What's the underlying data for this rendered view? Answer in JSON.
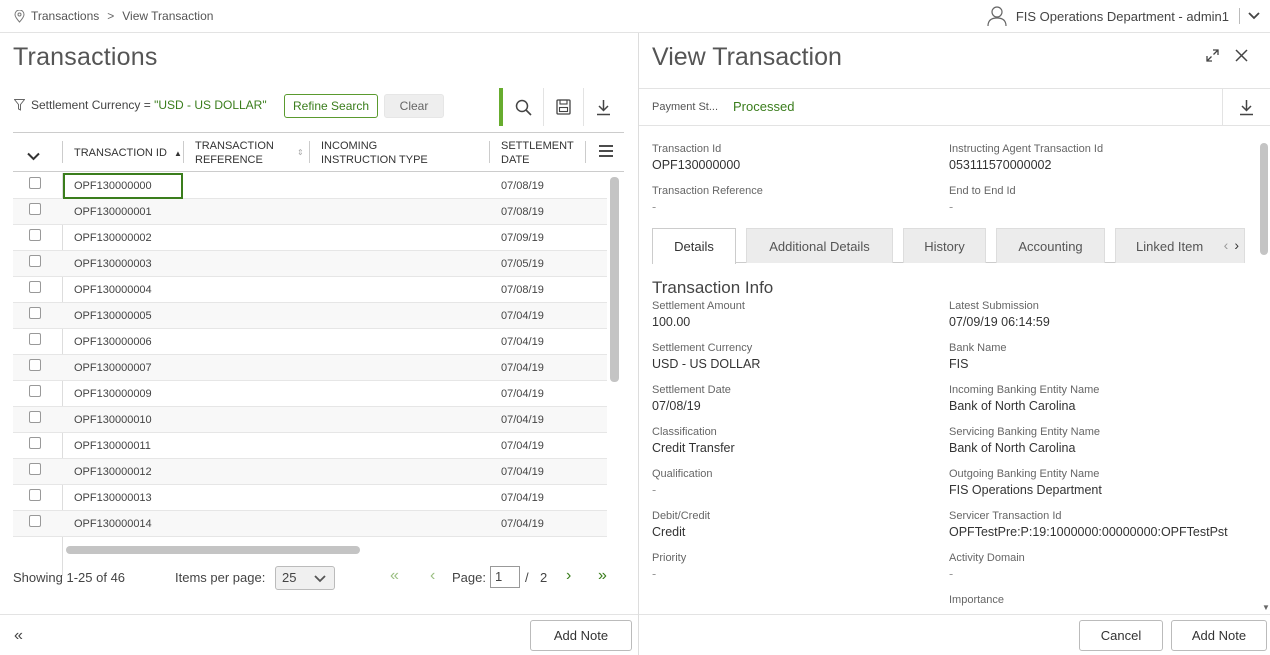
{
  "breadcrumb": {
    "root": "Transactions",
    "separator": ">",
    "current": "View Transaction"
  },
  "user": {
    "label": "FIS Operations Department - admin1"
  },
  "left": {
    "title": "Transactions",
    "filter": {
      "prefix": "Settlement Currency = ",
      "value": "\"USD - US DOLLAR\""
    },
    "refine_label": "Refine Search",
    "clear_label": "Clear",
    "columns": [
      "TRANSACTION ID",
      "TRANSACTION REFERENCE",
      "INCOMING INSTRUCTION TYPE",
      "SETTLEMENT DATE"
    ],
    "rows": [
      {
        "id": "OPF130000000",
        "date": "07/08/19"
      },
      {
        "id": "OPF130000001",
        "date": "07/08/19"
      },
      {
        "id": "OPF130000002",
        "date": "07/09/19"
      },
      {
        "id": "OPF130000003",
        "date": "07/05/19"
      },
      {
        "id": "OPF130000004",
        "date": "07/08/19"
      },
      {
        "id": "OPF130000005",
        "date": "07/04/19"
      },
      {
        "id": "OPF130000006",
        "date": "07/04/19"
      },
      {
        "id": "OPF130000007",
        "date": "07/04/19"
      },
      {
        "id": "OPF130000009",
        "date": "07/04/19"
      },
      {
        "id": "OPF130000010",
        "date": "07/04/19"
      },
      {
        "id": "OPF130000011",
        "date": "07/04/19"
      },
      {
        "id": "OPF130000012",
        "date": "07/04/19"
      },
      {
        "id": "OPF130000013",
        "date": "07/04/19"
      },
      {
        "id": "OPF130000014",
        "date": "07/04/19"
      }
    ],
    "pager": {
      "showing": "Showing 1-25 of 46",
      "items_per_page_label": "Items per page:",
      "items_per_page": "25",
      "page_label": "Page:",
      "page": "1",
      "slash": "/",
      "total_pages": "2"
    },
    "add_note_label": "Add Note"
  },
  "right": {
    "title": "View Transaction",
    "status_label": "Payment St...",
    "status_value": "Processed",
    "top_fields": [
      {
        "label": "Transaction Id",
        "value": "OPF130000000"
      },
      {
        "label": "Instructing Agent Transaction Id",
        "value": "053111570000002"
      },
      {
        "label": "Transaction Reference",
        "value": "-"
      },
      {
        "label": "End to End Id",
        "value": "-"
      }
    ],
    "tabs": [
      "Details",
      "Additional Details",
      "History",
      "Accounting",
      "Linked Item"
    ],
    "section_title": "Transaction Info",
    "left_fields": [
      {
        "label": "Settlement Amount",
        "value": "100.00"
      },
      {
        "label": "Settlement Currency",
        "value": "USD - US DOLLAR"
      },
      {
        "label": "Settlement Date",
        "value": "07/08/19"
      },
      {
        "label": "Classification",
        "value": "Credit Transfer"
      },
      {
        "label": "Qualification",
        "value": "-"
      },
      {
        "label": "Debit/Credit",
        "value": "Credit"
      },
      {
        "label": "Priority",
        "value": "-"
      }
    ],
    "right_fields": [
      {
        "label": "Latest Submission",
        "value": "07/09/19 06:14:59"
      },
      {
        "label": "Bank Name",
        "value": "FIS"
      },
      {
        "label": "Incoming Banking Entity Name",
        "value": "Bank of North Carolina"
      },
      {
        "label": "Servicing Banking Entity Name",
        "value": "Bank of North Carolina"
      },
      {
        "label": "Outgoing Banking Entity Name",
        "value": "FIS Operations Department"
      },
      {
        "label": "Servicer Transaction Id",
        "value": "OPFTestPre:P:19:1000000:00000000:OPFTestPst"
      },
      {
        "label": "Activity Domain",
        "value": "-"
      },
      {
        "label": "Importance",
        "value": ""
      }
    ],
    "cancel_label": "Cancel",
    "add_note_label": "Add Note"
  },
  "colors": {
    "accent": "#3a7d1c",
    "accent_bar": "#67ac2e"
  }
}
